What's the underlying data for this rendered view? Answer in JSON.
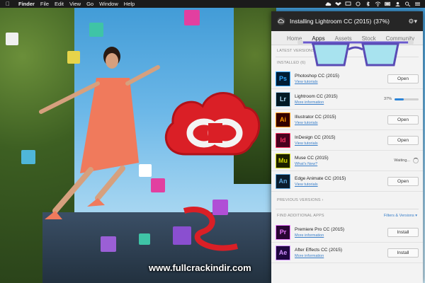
{
  "menubar": {
    "app_name": "Finder",
    "items": [
      "File",
      "Edit",
      "View",
      "Go",
      "Window",
      "Help"
    ]
  },
  "panel": {
    "title": "Installing Lightroom CC (2015)",
    "progress_text": "(37%)",
    "tabs": [
      {
        "label": "Home",
        "active": false
      },
      {
        "label": "Apps",
        "active": true
      },
      {
        "label": "Assets",
        "active": false
      },
      {
        "label": "Stock",
        "active": false
      },
      {
        "label": "Community",
        "active": false
      }
    ],
    "latest_versions_label": "LATEST VERSIONS",
    "installed_label": "INSTALLED (6)",
    "installed_apps": [
      {
        "abbr": "Ps",
        "name": "Photoshop CC (2015)",
        "link": "View tutorials",
        "action": "Open",
        "icon_bg": "#001d34",
        "icon_fg": "#31a8ff"
      },
      {
        "abbr": "Lr",
        "name": "Lightroom CC (2015)",
        "link": "More information",
        "status": "37%",
        "progress": 0.37,
        "icon_bg": "#001a24",
        "icon_fg": "#add5ec"
      },
      {
        "abbr": "Ai",
        "name": "Illustrator CC (2015)",
        "link": "View tutorials",
        "action": "Open",
        "icon_bg": "#330000",
        "icon_fg": "#ff9a00"
      },
      {
        "abbr": "Id",
        "name": "InDesign CC (2015)",
        "link": "View tutorials",
        "action": "Open",
        "icon_bg": "#49021f",
        "icon_fg": "#ff3366"
      },
      {
        "abbr": "Mu",
        "name": "Muse CC (2015)",
        "link": "What's New?",
        "status": "Waiting...",
        "icon_bg": "#1c2000",
        "icon_fg": "#d4db00"
      },
      {
        "abbr": "An",
        "name": "Edge Animate CC (2015)",
        "link": "View tutorials",
        "action": "Open",
        "icon_bg": "#0b1d2d",
        "icon_fg": "#5ba3d9"
      }
    ],
    "previous_versions_label": "PREVIOUS VERSIONS",
    "find_apps_label": "FIND ADDITIONAL APPS",
    "filters_label": "Filters & Versions",
    "additional_apps": [
      {
        "abbr": "Pr",
        "name": "Premiere Pro CC (2015)",
        "link": "More information",
        "action": "Install",
        "icon_bg": "#2a0634",
        "icon_fg": "#ea77ff"
      },
      {
        "abbr": "Ae",
        "name": "After Effects CC (2015)",
        "link": "More information",
        "action": "Install",
        "icon_bg": "#1f0740",
        "icon_fg": "#d291ff"
      }
    ]
  },
  "watermark": "www.fullcrackindir.com",
  "colors": {
    "accent": "#2b84d8",
    "cc_red": "#da1f26",
    "panel_header": "#262626"
  }
}
